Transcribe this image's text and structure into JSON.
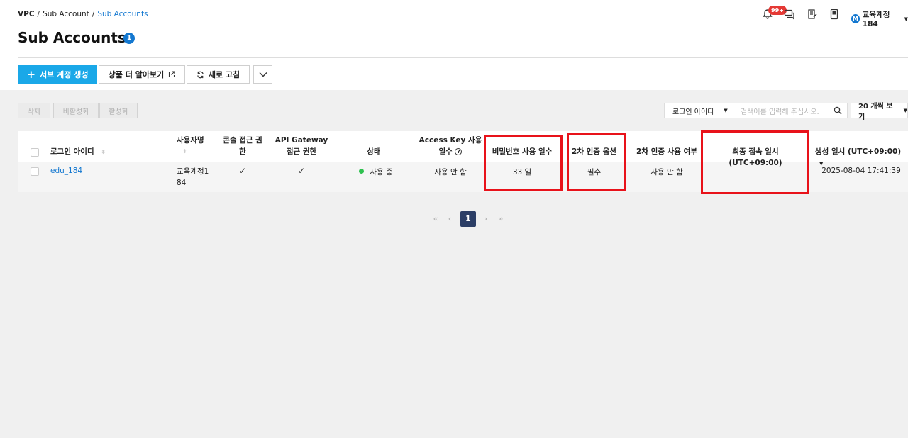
{
  "breadcrumb": {
    "root": "VPC",
    "sep": "/",
    "parent": "Sub Account",
    "current": "Sub Accounts"
  },
  "page": {
    "title": "Sub Accounts",
    "count": "1"
  },
  "header": {
    "notif_badge": "99+",
    "avatar_initial": "M",
    "user_name": "교육계정184"
  },
  "toolbar": {
    "create": "서브 계정 생성",
    "learn_more": "상품 더 알아보기",
    "refresh": "새로 고침"
  },
  "actions": {
    "delete": "삭제",
    "deactivate": "비활성화",
    "activate": "활성화"
  },
  "filter": {
    "field": "로그인 아이디",
    "search_placeholder": "검색어를 입력해 주십시오.",
    "per_page": "20 개씩 보기"
  },
  "table": {
    "headers": {
      "login_id": "로그인 아이디",
      "user_name": "사용자명",
      "console_line1": "콘솔 접근 권",
      "console_line2": "한",
      "api_line1": "API Gateway",
      "api_line2": "접근 권한",
      "status": "상태",
      "accesskey_line1": "Access Key 사용",
      "accesskey_line2": "일수",
      "pw_days": "비밀번호 사용 일수",
      "twofa_option": "2차 인증 옵션",
      "twofa_use": "2차 인증 사용 여부",
      "last_login": "최종 접속 일시 (UTC+09:00)",
      "created": "생성 일시 (UTC+09:00)"
    },
    "rows": [
      {
        "login_id": "edu_184",
        "user_name_line1": "교육계정1",
        "user_name_line2": "84",
        "console": "✓",
        "api": "✓",
        "status": "사용 중",
        "accesskey_days": "사용 안 함",
        "pw_days": "33 일",
        "twofa_option": "필수",
        "twofa_use": "사용 안 함",
        "last_login": "",
        "created": "2025-08-04 17:41:39"
      }
    ]
  },
  "pagination": {
    "first": "«",
    "prev": "‹",
    "current": "1",
    "next": "›",
    "last": "»"
  },
  "colors": {
    "primary": "#1aa8e8",
    "link": "#1478d0",
    "highlight": "#e8121a",
    "status_active": "#2ec14f",
    "pager_active": "#2c3e66"
  }
}
